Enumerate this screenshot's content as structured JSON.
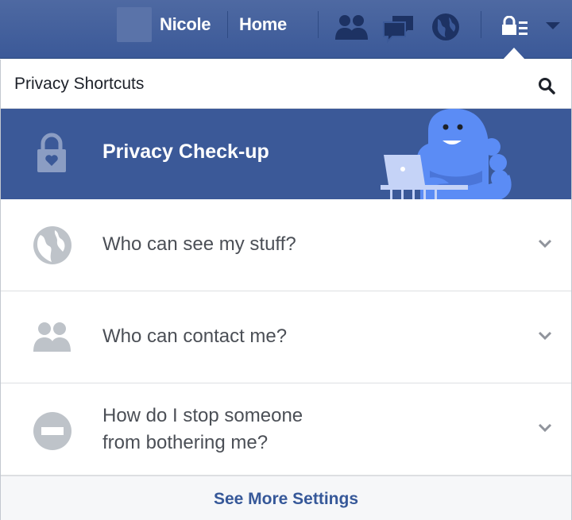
{
  "topbar": {
    "user_name": "Nicole",
    "home_label": "Home",
    "icons": [
      "friend-requests-icon",
      "messages-icon",
      "notifications-globe-icon",
      "privacy-shortcuts-icon",
      "account-menu-caret-icon"
    ]
  },
  "panel": {
    "title": "Privacy Shortcuts",
    "hero_title": "Privacy Check-up",
    "rows": [
      {
        "label_line1": "Who can see my stuff?",
        "label_line2": "",
        "icon": "globe-icon"
      },
      {
        "label_line1": "Who can contact me?",
        "label_line2": "",
        "icon": "people-icon"
      },
      {
        "label_line1": "How do I stop someone",
        "label_line2": "from bothering me?",
        "icon": "block-icon"
      }
    ],
    "footer_link": "See More Settings"
  },
  "colors": {
    "brand_blue": "#3b5998",
    "icon_gray": "#bec3c9",
    "chevron": "#90949c",
    "link": "#365899"
  }
}
